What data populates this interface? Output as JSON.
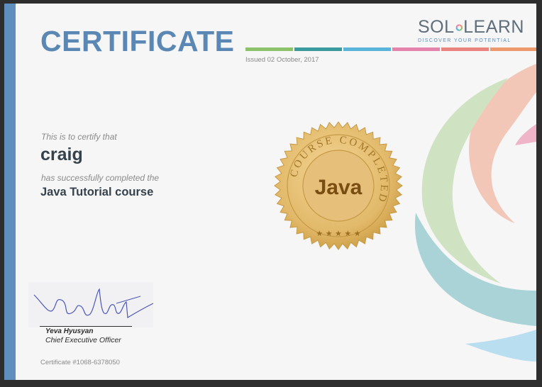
{
  "certificate": {
    "title": "CERTIFICATE",
    "issued": "Issued 02 October, 2017",
    "certify_text": "This is to certify that",
    "recipient_name": "craig",
    "completed_text": "has successfully completed the",
    "course_name": "Java Tutorial course",
    "certificate_number": "Certificate #1068-6378050"
  },
  "brand": {
    "logo_left": "SOL",
    "logo_right": "LEARN",
    "tagline": "DISCOVER YOUR POTENTIAL"
  },
  "seal": {
    "ring_text": "COURSE COMPLETED",
    "center_text": "Java",
    "stars": "★ ★ ★ ★ ★"
  },
  "signature": {
    "name": "Yeva Hyusyan",
    "role": "Chief Executive Officer"
  },
  "colors": {
    "stripes": [
      "#8cc26a",
      "#3a9a9e",
      "#5ab3d8",
      "#e484ac",
      "#e98480",
      "#ec9a6c"
    ],
    "accent": "#5f8fbe"
  }
}
